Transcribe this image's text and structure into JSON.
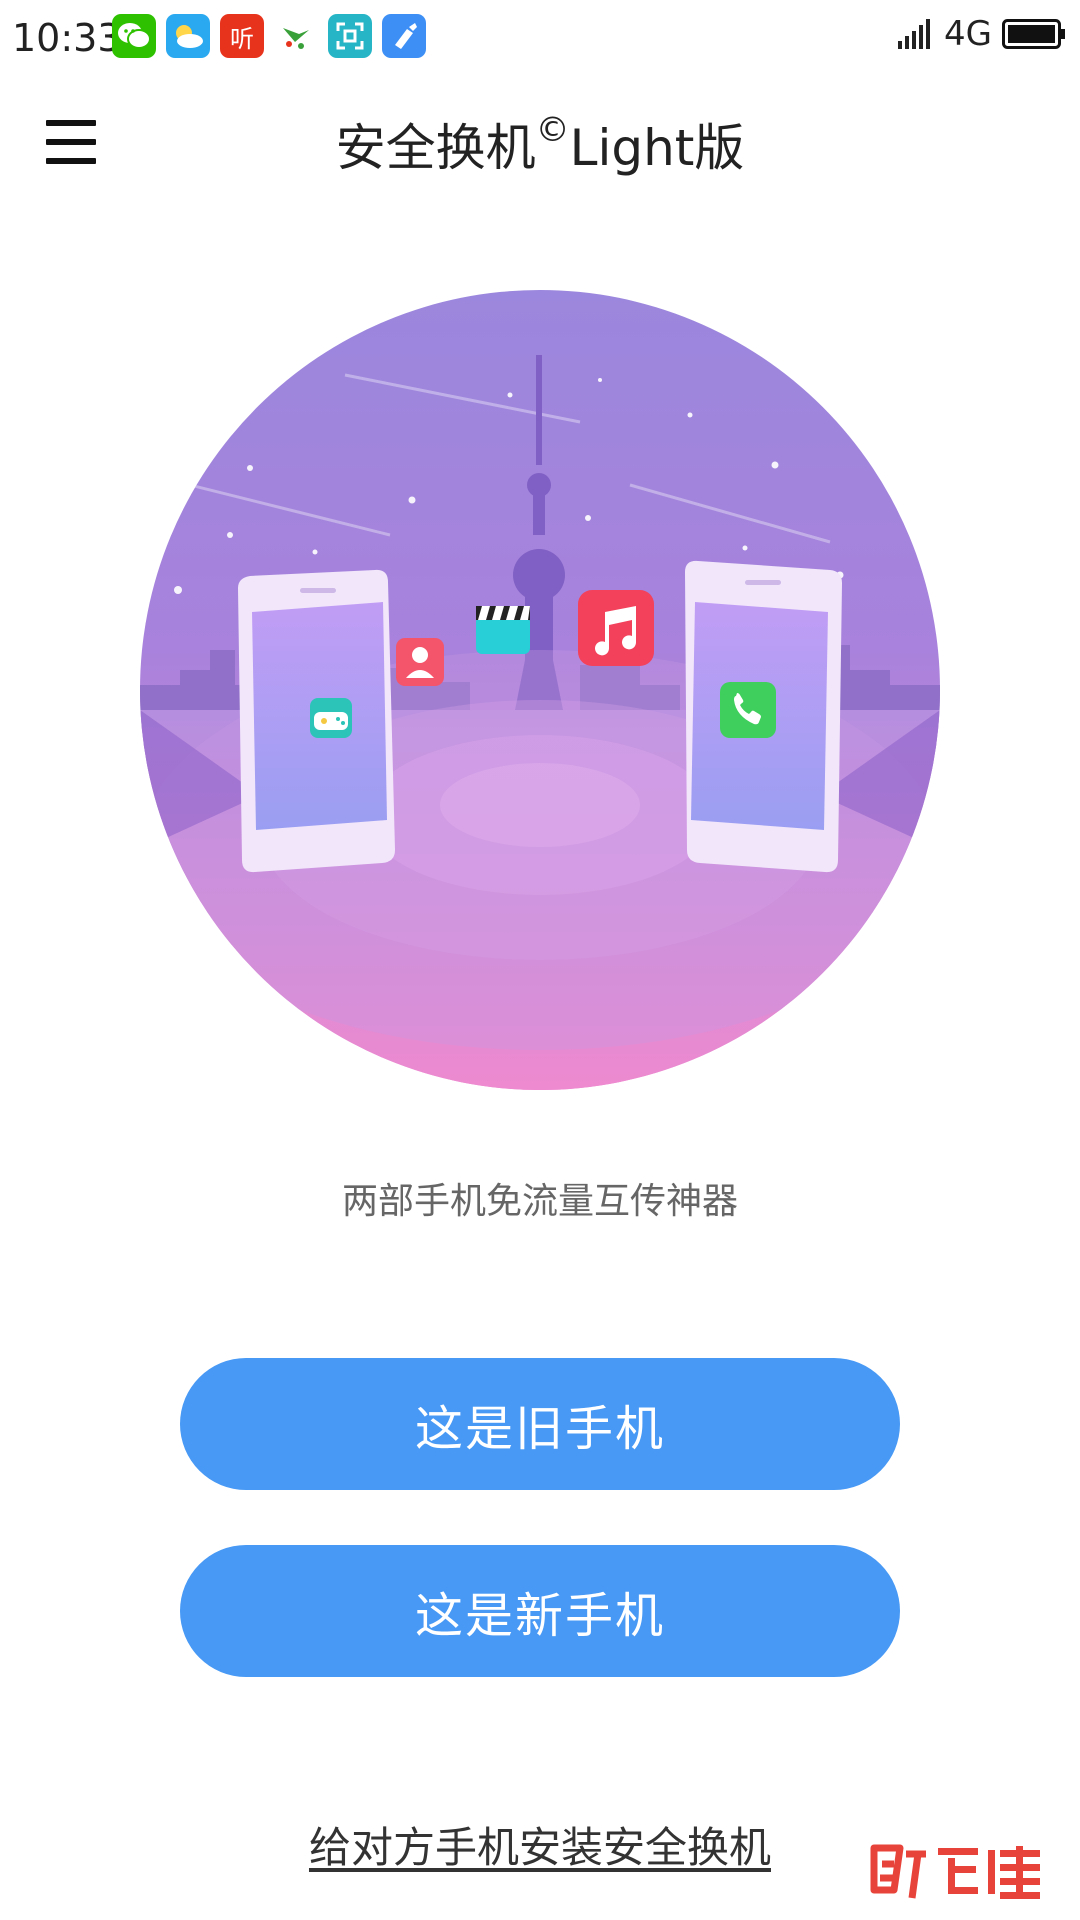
{
  "status_bar": {
    "time": "10:33",
    "network": "4G",
    "notifications": [
      {
        "icon": "wechat-icon",
        "color": "#2dc100",
        "glyph": "●"
      },
      {
        "icon": "weather-icon",
        "color": "#2aa9f0",
        "glyph": "☁"
      },
      {
        "icon": "listen-app-icon",
        "color": "#e8331c",
        "glyph": "听"
      },
      {
        "icon": "bird-app-icon",
        "color": "#ffffff",
        "glyph": ""
      },
      {
        "icon": "scan-icon",
        "color": "#26b5c6",
        "glyph": ""
      },
      {
        "icon": "cleaner-icon",
        "color": "#3d8ff5",
        "glyph": ""
      }
    ]
  },
  "header": {
    "title_main": "安全换机",
    "title_mark": "©",
    "title_suffix": "Light版"
  },
  "tagline": "两部手机免流量互传神器",
  "buttons": {
    "old_phone": "这是旧手机",
    "new_phone": "这是新手机"
  },
  "install_link": "给对方手机安装安全换机",
  "watermark_text": "百佳",
  "colors": {
    "accent": "#4799f5",
    "circle_top": "#9b87dd",
    "circle_bottom": "#f08ad0"
  },
  "illustration_icons": [
    "game-icon",
    "contact-icon",
    "video-icon",
    "music-icon",
    "phone-call-icon"
  ]
}
